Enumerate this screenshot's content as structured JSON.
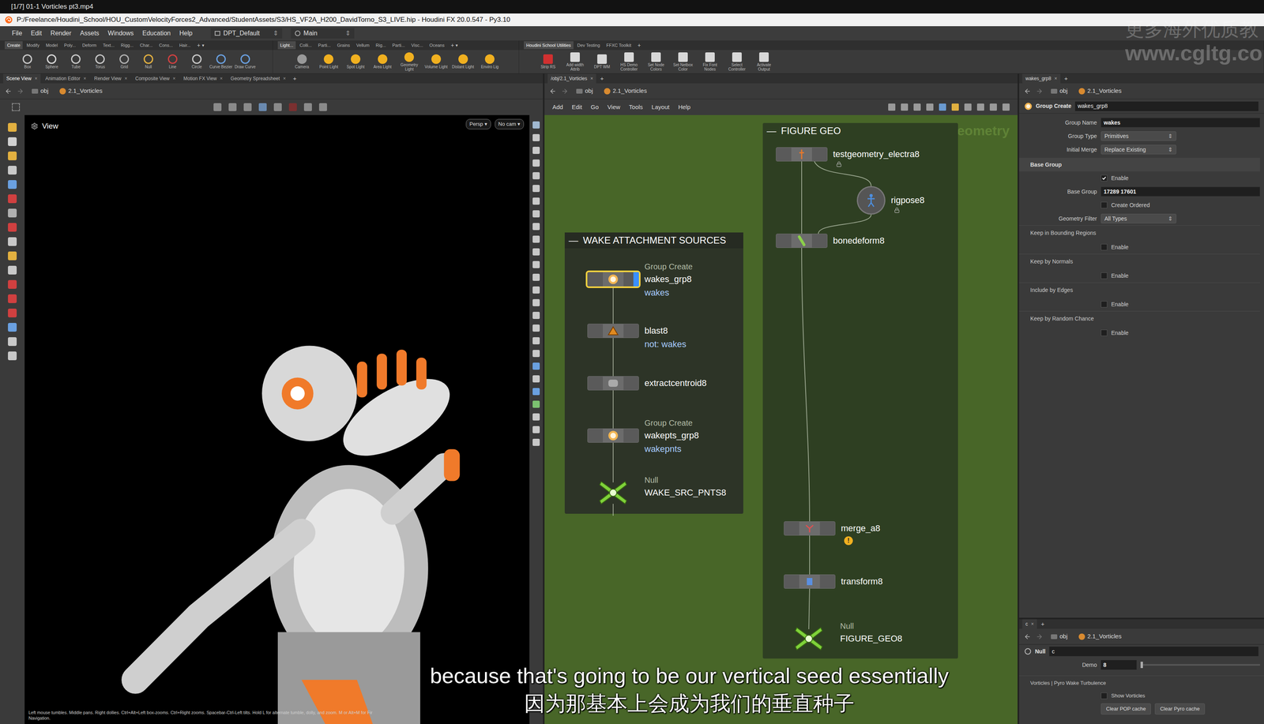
{
  "video_bar": {
    "title": "[1/7] 01-1 Vorticles pt3.mp4"
  },
  "window": {
    "title": "P:/Freelance/Houdini_School/HOU_CustomVelocityForces2_Advanced/StudentAssets/S3/HS_VF2A_H200_DavidTorno_S3_LIVE.hip - Houdini FX 20.0.547 - Py3.10"
  },
  "glyphs": {
    "close": "×",
    "add": "+",
    "menu_arrow": "⇕",
    "dropdown": "▾"
  },
  "menu": [
    "File",
    "Edit",
    "Render",
    "Assets",
    "Windows",
    "Education",
    "Help"
  ],
  "desktop": "DPT_Default",
  "runtime": "Main",
  "shelf_sets": [
    {
      "tabs": [
        {
          "label": "Create",
          "selected": true
        },
        {
          "label": "Modify",
          "selected": false
        },
        {
          "label": "Model",
          "selected": false
        },
        {
          "label": "Poly...",
          "selected": false
        },
        {
          "label": "Deform",
          "selected": false
        },
        {
          "label": "Text...",
          "selected": false
        },
        {
          "label": "Rigg...",
          "selected": false
        },
        {
          "label": "Char...",
          "selected": false
        },
        {
          "label": "Cons...",
          "selected": false
        },
        {
          "label": "Hair...",
          "selected": false
        }
      ],
      "tools": [
        "Box",
        "Sphere",
        "Tube",
        "Torus",
        "Grid",
        "Null",
        "Line",
        "Circle",
        "Curve Bezier",
        "Draw Curve"
      ]
    },
    {
      "tabs": [
        {
          "label": "Light...",
          "selected": true
        },
        {
          "label": "Colli...",
          "selected": false
        },
        {
          "label": "Parti...",
          "selected": false
        },
        {
          "label": "Grains",
          "selected": false
        },
        {
          "label": "Vellum",
          "selected": false
        },
        {
          "label": "Rig...",
          "selected": false
        },
        {
          "label": "Parti...",
          "selected": false
        },
        {
          "label": "Visc...",
          "selected": false
        },
        {
          "label": "Oceans",
          "selected": false
        }
      ],
      "tools": [
        "Camera",
        "Point Light",
        "Spot Light",
        "Area Light",
        "Geometry Light",
        "Volume Light",
        "Distant Light",
        "Enviro Lig"
      ]
    },
    {
      "tabs": [
        {
          "label": "Houdini School Utilities",
          "selected": true
        },
        {
          "label": "Dev Testing",
          "selected": false
        },
        {
          "label": "FFXC Toolkit",
          "selected": false
        }
      ],
      "tools": [
        "Strip RS",
        "Add width Attrib",
        "DPT WM",
        "HS Demo Controller",
        "Set Node Colors",
        "Set Netbox Color",
        "Fix Font Nodes",
        "Select Controller",
        "Activate Output"
      ]
    }
  ],
  "pane_tabs": [
    {
      "label": "Scene View",
      "selected": true
    },
    {
      "label": "Animation Editor",
      "selected": false
    },
    {
      "label": "Render View",
      "selected": false
    },
    {
      "label": "Composite View",
      "selected": false
    },
    {
      "label": "Motion FX View",
      "selected": false
    },
    {
      "label": "Geometry Spreadsheet",
      "selected": false
    }
  ],
  "viewport": {
    "path": [
      "obj",
      "2.1_Vorticles"
    ],
    "label": "View",
    "camera": "Persp",
    "cam": "No cam",
    "status": [
      "Left mouse tumbles. Middle pans. Right dollies. Ctrl+Alt+Left box-zooms. Ctrl+Right zooms. Spacebar-Ctrl-Left tilts. Hold L for alternate tumble, dolly, and zoom.   M or Alt+M for Fir",
      "Navigation."
    ]
  },
  "network": {
    "tab": "/obj/2.1_Vorticles",
    "path": [
      "obj",
      "2.1_Vorticles"
    ],
    "menu": [
      "Add",
      "Edit",
      "Go",
      "View",
      "Tools",
      "Layout",
      "Help"
    ],
    "context_label": "Geometry",
    "boxes": [
      {
        "title": "FIGURE GEO",
        "collapse": "—"
      },
      {
        "title": "WAKE ATTACHMENT SOURCES",
        "collapse": "—"
      }
    ],
    "nodes": [
      {
        "kind": "group",
        "type": "Group Create",
        "name": "wakes_grp8",
        "comment": "wakes",
        "selected": true,
        "locked": false,
        "warning": ""
      },
      {
        "kind": "blast",
        "type": "",
        "name": "blast8",
        "comment": "not: wakes",
        "selected": false,
        "locked": false,
        "warning": ""
      },
      {
        "kind": "extract",
        "type": "",
        "name": "extractcentroid8",
        "comment": "",
        "selected": false,
        "locked": false,
        "warning": ""
      },
      {
        "kind": "group",
        "type": "Group Create",
        "name": "wakepts_grp8",
        "comment": "wakepnts",
        "selected": false,
        "locked": false,
        "warning": ""
      },
      {
        "kind": "null",
        "type": "Null",
        "name": "WAKE_SRC_PNTS8",
        "comment": "",
        "selected": false,
        "locked": false,
        "warning": ""
      },
      {
        "kind": "testgeo",
        "type": "",
        "name": "testgeometry_electra8",
        "comment": "",
        "selected": false,
        "locked": true,
        "warning": ""
      },
      {
        "kind": "rigpose",
        "type": "",
        "name": "rigpose8",
        "comment": "",
        "selected": false,
        "locked": true,
        "warning": ""
      },
      {
        "kind": "bonedeform",
        "type": "",
        "name": "bonedeform8",
        "comment": "",
        "selected": false,
        "locked": false,
        "warning": ""
      },
      {
        "kind": "merge",
        "type": "",
        "name": "merge_a8",
        "comment": "",
        "selected": false,
        "locked": false,
        "warning": "!"
      },
      {
        "kind": "transform",
        "type": "",
        "name": "transform8",
        "comment": "",
        "selected": false,
        "locked": false,
        "warning": ""
      },
      {
        "kind": "null",
        "type": "Null",
        "name": "FIGURE_GEO8",
        "comment": "",
        "selected": false,
        "locked": false,
        "warning": ""
      }
    ]
  },
  "params": {
    "tab": "wakes_grp8",
    "path": [
      "obj",
      "2.1_Vorticles"
    ],
    "node_type": "Group Create",
    "node_name": "wakes_grp8",
    "rows": [
      {
        "kind": "field",
        "label": "Group Name",
        "value": "wakes"
      },
      {
        "kind": "menu",
        "label": "Group Type",
        "value": "Primitives"
      },
      {
        "kind": "menu",
        "label": "Initial Merge",
        "value": "Replace Existing"
      },
      {
        "kind": "section",
        "label": "Base Group"
      },
      {
        "kind": "checkbox",
        "label": "Enable",
        "checked": true
      },
      {
        "kind": "field",
        "label": "Base Group",
        "value": "17289 17601"
      },
      {
        "kind": "checkbox",
        "label": "Create Ordered",
        "checked": false
      },
      {
        "kind": "menu",
        "label": "Geometry Filter",
        "value": "All Types"
      },
      {
        "kind": "folder",
        "label": "Keep in Bounding Regions"
      },
      {
        "kind": "checkbox",
        "label": "Enable",
        "checked": false
      },
      {
        "kind": "folder",
        "label": "Keep by Normals"
      },
      {
        "kind": "checkbox",
        "label": "Enable",
        "checked": false
      },
      {
        "kind": "folder",
        "label": "Include by Edges"
      },
      {
        "kind": "checkbox",
        "label": "Enable",
        "checked": false
      },
      {
        "kind": "folder",
        "label": "Keep by Random Chance"
      },
      {
        "kind": "checkbox",
        "label": "Enable",
        "checked": false
      }
    ]
  },
  "lower_params": {
    "tab": "c",
    "path": [
      "obj",
      "2.1_Vorticles"
    ],
    "node_type": "Null",
    "node_name": "c",
    "demo": {
      "label": "Demo",
      "value": "8",
      "level": 0
    },
    "section": "Vorticles | Pyro Wake Turbulence",
    "show": {
      "label": "Show Vorticles",
      "checked": false
    },
    "buttons": [
      "Clear POP cache",
      "Clear Pyro cache"
    ]
  },
  "subtitles": [
    "because that's going to be our vertical seed essentially",
    "因为那基本上会成为我们的垂直种子"
  ],
  "watermark": [
    "更多海外优质教",
    "www.cgltg.co"
  ]
}
